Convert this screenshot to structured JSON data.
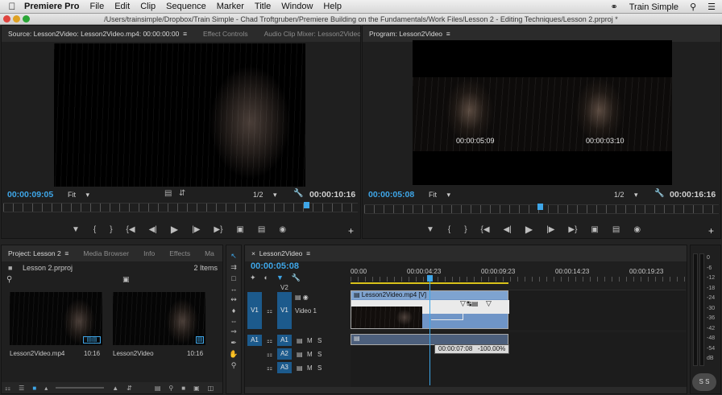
{
  "menubar": {
    "app": "Premiere Pro",
    "items": [
      "File",
      "Edit",
      "Clip",
      "Sequence",
      "Marker",
      "Title",
      "Window",
      "Help"
    ],
    "user": "Train Simple"
  },
  "window": {
    "path": "/Users/trainsimple/Dropbox/Train Simple - Chad Troftgruben/Premiere Building on the Fundamentals/Work Files/Lesson 2 - Editing Techniques/Lesson 2.prproj *"
  },
  "source": {
    "tab_active": "Source: Lesson2Video: Lesson2Video.mp4: 00:00:00:00",
    "tab_effect_controls": "Effect Controls",
    "tab_audio_mixer": "Audio Clip Mixer: Lesson2Video",
    "timecode": "00:00:09:05",
    "fit": "Fit",
    "resolution": "1/2",
    "duration": "00:00:10:16",
    "playhead_fraction": 0.855
  },
  "program": {
    "tab": "Program: Lesson2Video",
    "timecode": "00:00:05:08",
    "fit": "Fit",
    "resolution": "1/2",
    "duration": "00:00:16:16",
    "left_tc": "00:00:05:09",
    "right_tc": "00:00:03:10",
    "playhead_fraction": 0.495
  },
  "project": {
    "tab_active": "Project: Lesson 2",
    "tab_media_browser": "Media Browser",
    "tab_info": "Info",
    "tab_effects": "Effects",
    "tab_more": "Ma",
    "file": "Lesson 2.prproj",
    "item_count": "2 Items",
    "items": [
      {
        "name": "Lesson2Video.mp4",
        "duration": "10:16"
      },
      {
        "name": "Lesson2Video",
        "duration": "10:16"
      }
    ]
  },
  "timeline": {
    "tab": "Lesson2Video",
    "timecode": "00:00:05:08",
    "ruler": [
      "00:00",
      "00:00:04:23",
      "00:00:09:23",
      "00:00:14:23",
      "00:00:19:23"
    ],
    "tracks": {
      "v2": "V2",
      "v1_src": "V1",
      "v1": "V1",
      "v1_name": "Video 1",
      "a1_src": "A1",
      "a1": "A1",
      "a2": "A2",
      "a3": "A3",
      "m": "M",
      "s": "S"
    },
    "clip_name": "Lesson2Video.mp4 [V]",
    "tooltip": "00:00:07:08   -100.00%"
  },
  "meter": {
    "labels": [
      "0",
      "-6",
      "-12",
      "-18",
      "-24",
      "-30",
      "-36",
      "-42",
      "-48",
      "-54",
      "dB"
    ],
    "footer": "S S"
  },
  "colors": {
    "accent_blue": "#3ea6e8",
    "track_blue": "#1c5a8c",
    "clip_blue": "#6f95c7",
    "panel_bg": "#1f1f1f"
  }
}
